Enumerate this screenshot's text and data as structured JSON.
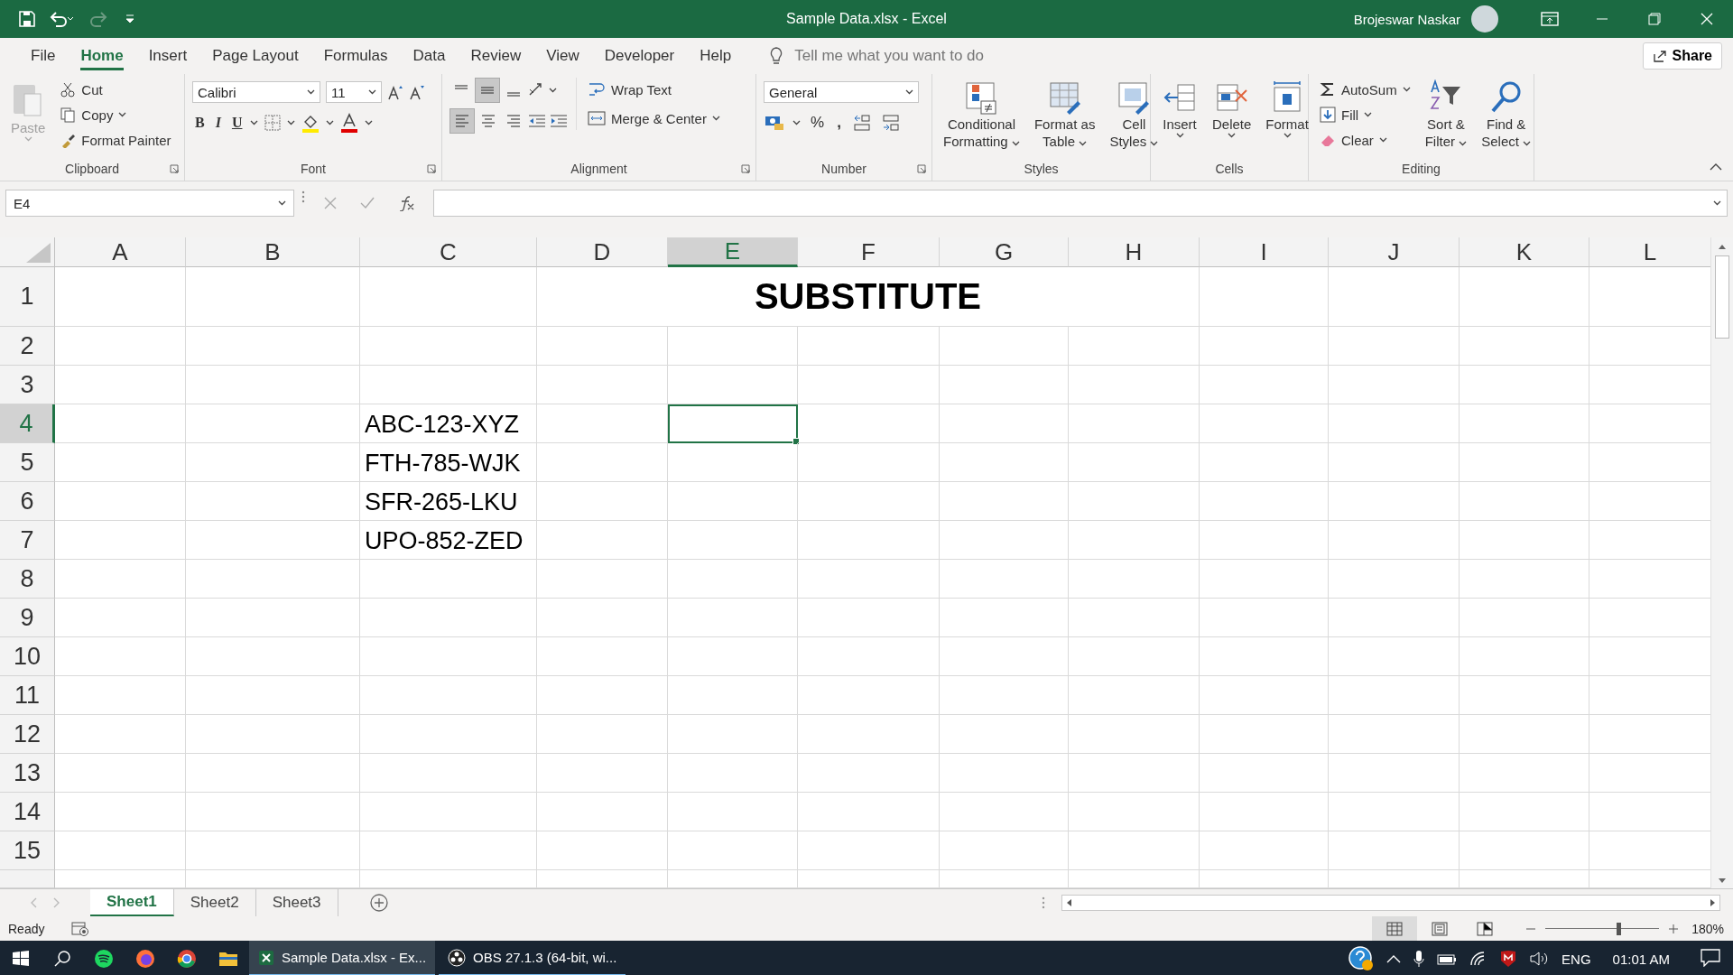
{
  "window": {
    "title": "Sample Data.xlsx  -  Excel",
    "user": "Brojeswar Naskar"
  },
  "menu_tabs": [
    {
      "label": "File",
      "selected": false
    },
    {
      "label": "Home",
      "selected": true
    },
    {
      "label": "Insert",
      "selected": false
    },
    {
      "label": "Page Layout",
      "selected": false
    },
    {
      "label": "Formulas",
      "selected": false
    },
    {
      "label": "Data",
      "selected": false
    },
    {
      "label": "Review",
      "selected": false
    },
    {
      "label": "View",
      "selected": false
    },
    {
      "label": "Developer",
      "selected": false
    },
    {
      "label": "Help",
      "selected": false
    }
  ],
  "tell_me": {
    "placeholder": "Tell me what you want to do"
  },
  "share_button": "Share",
  "ribbon": [
    {
      "kind": "clipboard",
      "label": "Clipboard",
      "paste": {
        "label": "Paste",
        "disabled": true
      },
      "items": [
        "Cut",
        "Copy",
        "Format Painter"
      ]
    },
    {
      "kind": "font",
      "label": "Font",
      "font_name": "Calibri",
      "font_size": "11",
      "styles": [
        "B",
        "I",
        "U"
      ]
    },
    {
      "kind": "alignment",
      "label": "Alignment",
      "wrap": "Wrap Text",
      "merge": "Merge & Center",
      "align_buttons": [
        {
          "kind": "top",
          "selected": false
        },
        {
          "kind": "middle",
          "selected": true
        },
        {
          "kind": "bottom",
          "selected": false
        },
        {
          "kind": "left",
          "selected": true
        },
        {
          "kind": "center",
          "selected": false
        },
        {
          "kind": "right",
          "selected": false
        }
      ]
    },
    {
      "kind": "number",
      "label": "Number",
      "format": "General",
      "symbols": [
        "%",
        ","
      ]
    },
    {
      "kind": "styles",
      "label": "Styles",
      "buttons": [
        [
          "Conditional",
          "Formatting"
        ],
        [
          "Format as",
          "Table"
        ],
        [
          "Cell",
          "Styles"
        ]
      ]
    },
    {
      "kind": "cells",
      "label": "Cells",
      "buttons": [
        "Insert",
        "Delete",
        "Format"
      ]
    },
    {
      "kind": "editing",
      "label": "Editing",
      "items": [
        "AutoSum",
        "Fill",
        "Clear"
      ],
      "buttons": [
        [
          "Sort &",
          "Filter"
        ],
        [
          "Find &",
          "Select"
        ]
      ]
    }
  ],
  "name_box": "E4",
  "columns": [
    {
      "label": "A",
      "selected": false
    },
    {
      "label": "B",
      "selected": false
    },
    {
      "label": "C",
      "selected": false
    },
    {
      "label": "D",
      "selected": false
    },
    {
      "label": "E",
      "selected": true
    },
    {
      "label": "F",
      "selected": false
    },
    {
      "label": "G",
      "selected": false
    },
    {
      "label": "H",
      "selected": false
    },
    {
      "label": "I",
      "selected": false
    },
    {
      "label": "J",
      "selected": false
    },
    {
      "label": "K",
      "selected": false
    },
    {
      "label": "L",
      "selected": false
    }
  ],
  "rows": [
    {
      "label": "1",
      "selected": false,
      "merged_title": "SUBSTITUTE"
    },
    {
      "label": "2",
      "selected": false
    },
    {
      "label": "3",
      "selected": false
    },
    {
      "label": "4",
      "selected": true,
      "column_c": "ABC-123-XYZ"
    },
    {
      "label": "5",
      "selected": false,
      "column_c": "FTH-785-WJK"
    },
    {
      "label": "6",
      "selected": false,
      "column_c": "SFR-265-LKU"
    },
    {
      "label": "7",
      "selected": false,
      "column_c": "UPO-852-ZED"
    },
    {
      "label": "8",
      "selected": false
    },
    {
      "label": "9",
      "selected": false
    },
    {
      "label": "10",
      "selected": false
    },
    {
      "label": "11",
      "selected": false
    },
    {
      "label": "12",
      "selected": false
    },
    {
      "label": "13",
      "selected": false
    },
    {
      "label": "14",
      "selected": false
    },
    {
      "label": "15",
      "selected": false
    }
  ],
  "sheet_tabs": [
    {
      "label": "Sheet1",
      "selected": true
    },
    {
      "label": "Sheet2",
      "selected": false
    },
    {
      "label": "Sheet3",
      "selected": false
    }
  ],
  "status_bar": {
    "status": "Ready",
    "view_buttons": [
      {
        "kind": "normal",
        "selected": true
      },
      {
        "kind": "page_layout",
        "selected": false
      },
      {
        "kind": "page_break",
        "selected": false
      }
    ],
    "zoom_slider": {
      "level": 0.64
    },
    "zoom": "180%"
  },
  "taskbar": {
    "windows": [
      {
        "label": "Sample Data.xlsx - Ex...",
        "selected": true
      },
      {
        "label": "OBS 27.1.3 (64-bit, wi...",
        "selected": false
      }
    ],
    "language": "ENG",
    "time": "01:01 AM"
  }
}
